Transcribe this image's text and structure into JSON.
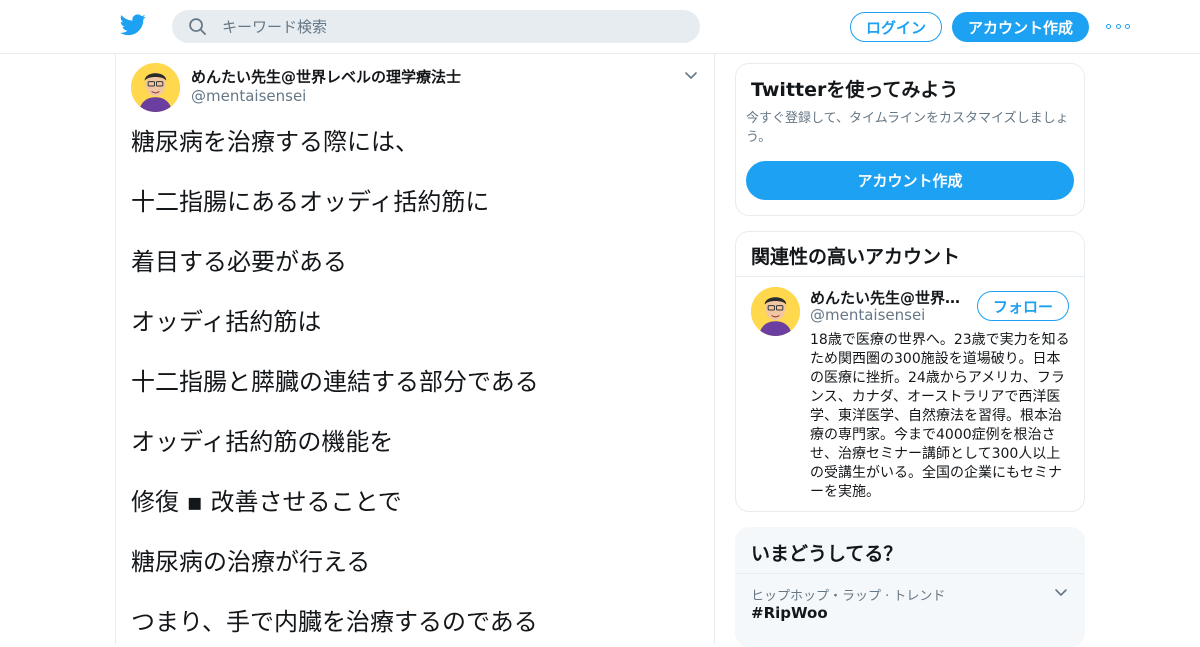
{
  "header": {
    "search_placeholder": "キーワード検索",
    "login_label": "ログイン",
    "signup_label": "アカウント作成"
  },
  "tweet": {
    "author_name": "めんたい先生@世界レベルの理学療法士",
    "author_handle": "@mentaisensei",
    "lines": [
      "糖尿病を治療する際には、",
      "十二指腸にあるオッディ括約筋に",
      "着目する必要がある",
      "オッディ括約筋は",
      "十二指腸と膵臓の連結する部分である",
      "オッディ括約筋の機能を",
      "修復 ▪ 改善させることで",
      "糖尿病の治療が行える",
      "つまり、手で内臓を治療するのである"
    ]
  },
  "signup_card": {
    "title": "Twitterを使ってみよう",
    "subtitle": "今すぐ登録して、タイムラインをカスタマイズしましょう。",
    "button_label": "アカウント作成"
  },
  "related_card": {
    "title": "関連性の高いアカウント",
    "account_name": "めんたい先生@世界…",
    "account_handle": "@mentaisensei",
    "follow_label": "フォロー",
    "bio": "18歳で医療の世界へ。23歳で実力を知るため関西圏の300施設を道場破り。日本の医療に挫折。24歳からアメリカ、フランス、カナダ、オーストラリアで西洋医学、東洋医学、自然療法を習得。根本治療の専門家。今まで4000症例を根治させ、治療セミナー講師として300人以上の受講生がいる。全国の企業にもセミナーを実施。"
  },
  "trends_card": {
    "title": "いまどうしてる？",
    "trend_context": "ヒップホップ・ラップ · トレンド",
    "trend_name": "#RipWoo"
  },
  "colors": {
    "brand_blue": "#1da1f2",
    "border_gray": "#e6ecf0",
    "secondary_text": "#657786"
  }
}
